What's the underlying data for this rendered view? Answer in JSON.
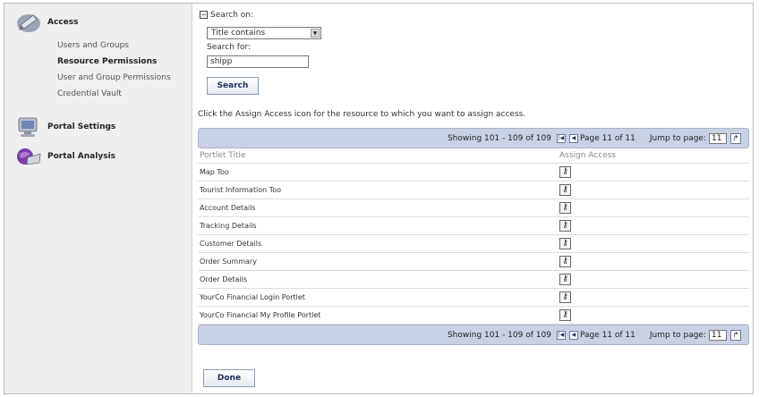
{
  "sidebar": {
    "sections": [
      {
        "title": "Access",
        "icon": "access-icon"
      },
      {
        "title": "Portal Settings",
        "icon": "portal-settings-icon"
      },
      {
        "title": "Portal Analysis",
        "icon": "portal-analysis-icon"
      }
    ],
    "items": [
      {
        "label": "Users and Groups",
        "active": false
      },
      {
        "label": "Resource Permissions",
        "active": true
      },
      {
        "label": "User and Group Permissions",
        "active": false
      },
      {
        "label": "Credential Vault",
        "active": false
      }
    ]
  },
  "search": {
    "search_on_label": "Search on:",
    "search_on_value": "Title contains",
    "search_for_label": "Search for:",
    "search_for_value": "shipp",
    "button_label": "Search"
  },
  "instructions": "Click the Assign Access icon for the resource to which you want to assign access.",
  "pager": {
    "showing": "Showing 101 - 109 of 109",
    "page": "Page 11 of 11",
    "jump_label": "Jump to page:",
    "jump_value": "11"
  },
  "table": {
    "columns": [
      "Portlet Title",
      "Assign Access"
    ],
    "rows": [
      "Map Too",
      "Tourist Information Too",
      "Account Details",
      "Tracking Details",
      "Customer Details",
      "Order Summary",
      "Order Details",
      "YourCo Financial Login Portlet",
      "YourCo Financial My Profile Portlet"
    ]
  },
  "done_label": "Done"
}
